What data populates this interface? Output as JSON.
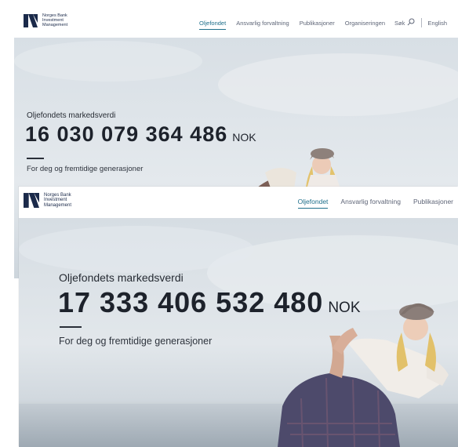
{
  "screens": [
    {
      "logo": {
        "line1": "Norges Bank",
        "line2": "Investment",
        "line3": "Management"
      },
      "nav": {
        "items": [
          {
            "label": "Oljefondet",
            "active": true
          },
          {
            "label": "Ansvarlig forvaltning",
            "active": false
          },
          {
            "label": "Publikasjoner",
            "active": false
          },
          {
            "label": "Organiseringen",
            "active": false
          }
        ],
        "search_label": "Søk",
        "language_label": "English"
      },
      "hero": {
        "kicker": "Oljefondets markedsverdi",
        "value": "16 030 079 364 486",
        "currency": "NOK",
        "tagline": "For deg og fremtidige generasjoner"
      }
    },
    {
      "logo": {
        "line1": "Norges Bank",
        "line2": "Investment",
        "line3": "Management"
      },
      "nav": {
        "items": [
          {
            "label": "Oljefondet",
            "active": true
          },
          {
            "label": "Ansvarlig forvaltning",
            "active": false
          },
          {
            "label": "Publikasjoner",
            "active": false
          }
        ]
      },
      "hero": {
        "kicker": "Oljefondets markedsverdi",
        "value": "17 333 406 532 480",
        "currency": "NOK",
        "tagline": "For deg og fremtidige generasjoner"
      }
    }
  ],
  "colors": {
    "brand_navy": "#1b2a4a",
    "nav_active": "#1f6f8b",
    "nav_text": "#5e6577",
    "hero_sky": "#dfe5ea",
    "hero_text": "#1d222b"
  },
  "icons": [
    "nbim-logo-icon",
    "search-icon"
  ]
}
